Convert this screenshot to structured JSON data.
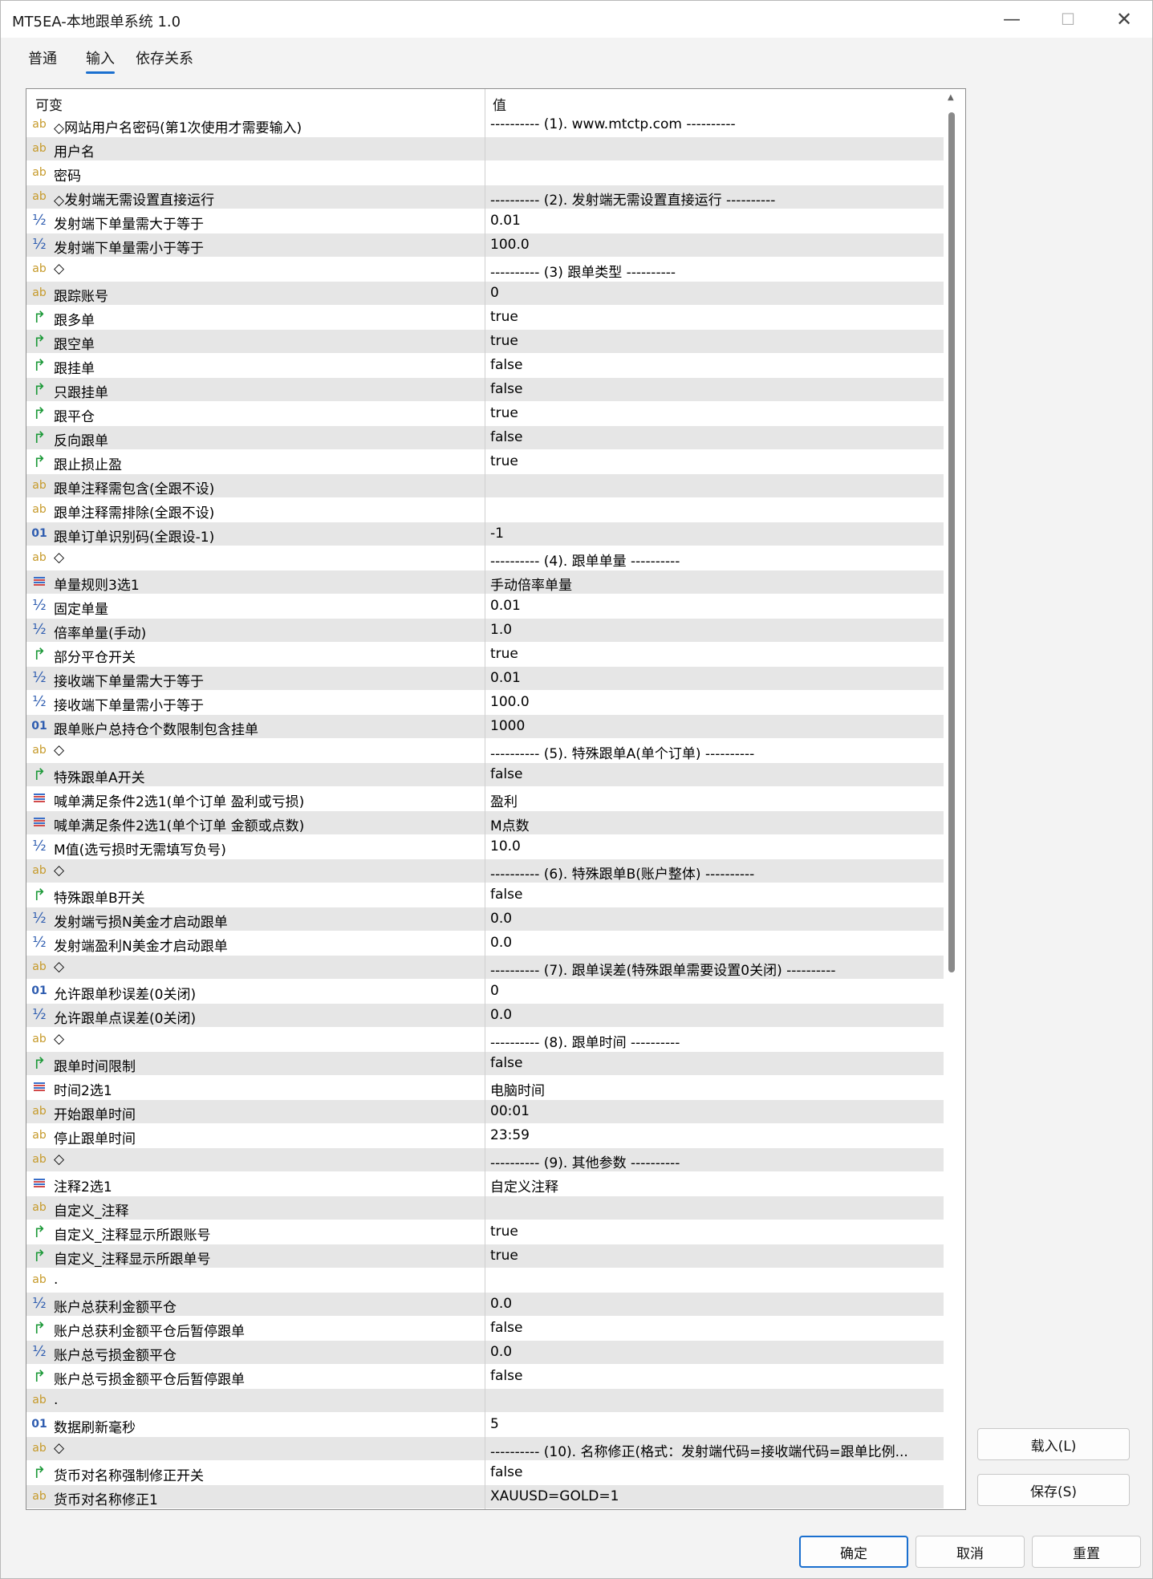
{
  "window": {
    "title": "MT5EA-本地跟单系统 1.0"
  },
  "tabs": [
    {
      "label": "普通",
      "active": false
    },
    {
      "label": "输入",
      "active": true
    },
    {
      "label": "依存关系",
      "active": false
    }
  ],
  "grid": {
    "header": {
      "name": "可变",
      "value": "值"
    },
    "rows": [
      {
        "icon": "ab",
        "name": "◇网站用户名密码(第1次使用才需要输入)",
        "value": "---------- (1). www.mtctp.com ----------"
      },
      {
        "icon": "ab",
        "name": "用户名",
        "value": ""
      },
      {
        "icon": "ab",
        "name": "密码",
        "value": ""
      },
      {
        "icon": "ab",
        "name": "◇发射端无需设置直接运行",
        "value": "---------- (2). 发射端无需设置直接运行 ----------"
      },
      {
        "icon": "half",
        "name": "发射端下单量需大于等于",
        "value": "0.01"
      },
      {
        "icon": "half",
        "name": "发射端下单量需小于等于",
        "value": "100.0"
      },
      {
        "icon": "ab",
        "name": "◇",
        "value": "---------- (3) 跟单类型 ----------"
      },
      {
        "icon": "ab",
        "name": "跟踪账号",
        "value": "0"
      },
      {
        "icon": "bool",
        "name": "跟多单",
        "value": "true"
      },
      {
        "icon": "bool",
        "name": "跟空单",
        "value": "true"
      },
      {
        "icon": "bool",
        "name": "跟挂单",
        "value": "false"
      },
      {
        "icon": "bool",
        "name": "只跟挂单",
        "value": "false"
      },
      {
        "icon": "bool",
        "name": "跟平仓",
        "value": "true"
      },
      {
        "icon": "bool",
        "name": "反向跟单",
        "value": "false"
      },
      {
        "icon": "bool",
        "name": "跟止损止盈",
        "value": "true"
      },
      {
        "icon": "ab",
        "name": "跟单注释需包含(全跟不设)",
        "value": ""
      },
      {
        "icon": "ab",
        "name": "跟单注释需排除(全跟不设)",
        "value": ""
      },
      {
        "icon": "num",
        "name": "跟单订单识别码(全跟设-1)",
        "value": "-1"
      },
      {
        "icon": "ab",
        "name": "◇",
        "value": "---------- (4). 跟单单量 ----------"
      },
      {
        "icon": "enum",
        "name": "单量规则3选1",
        "value": "手动倍率单量"
      },
      {
        "icon": "half",
        "name": "固定单量",
        "value": "0.01"
      },
      {
        "icon": "half",
        "name": "倍率单量(手动)",
        "value": "1.0"
      },
      {
        "icon": "bool",
        "name": "部分平仓开关",
        "value": "true"
      },
      {
        "icon": "half",
        "name": "接收端下单量需大于等于",
        "value": "0.01"
      },
      {
        "icon": "half",
        "name": "接收端下单量需小于等于",
        "value": "100.0"
      },
      {
        "icon": "num",
        "name": "跟单账户总持仓个数限制包含挂单",
        "value": "1000"
      },
      {
        "icon": "ab",
        "name": "◇",
        "value": "---------- (5). 特殊跟单A(单个订单) ----------"
      },
      {
        "icon": "bool",
        "name": "特殊跟单A开关",
        "value": "false"
      },
      {
        "icon": "enum",
        "name": "喊单满足条件2选1(单个订单 盈利或亏损)",
        "value": "盈利"
      },
      {
        "icon": "enum",
        "name": "喊单满足条件2选1(单个订单 金额或点数)",
        "value": "M点数"
      },
      {
        "icon": "half",
        "name": "M值(选亏损时无需填写负号)",
        "value": "10.0"
      },
      {
        "icon": "ab",
        "name": "◇",
        "value": "---------- (6). 特殊跟单B(账户整体) ----------"
      },
      {
        "icon": "bool",
        "name": "特殊跟单B开关",
        "value": "false"
      },
      {
        "icon": "half",
        "name": "发射端亏损N美金才启动跟单",
        "value": "0.0"
      },
      {
        "icon": "half",
        "name": "发射端盈利N美金才启动跟单",
        "value": "0.0"
      },
      {
        "icon": "ab",
        "name": "◇",
        "value": "---------- (7). 跟单误差(特殊跟单需要设置0关闭) ----------"
      },
      {
        "icon": "num",
        "name": "允许跟单秒误差(0关闭)",
        "value": "0"
      },
      {
        "icon": "half",
        "name": "允许跟单点误差(0关闭)",
        "value": "0.0"
      },
      {
        "icon": "ab",
        "name": "◇",
        "value": "---------- (8). 跟单时间 ----------"
      },
      {
        "icon": "bool",
        "name": "跟单时间限制",
        "value": "false"
      },
      {
        "icon": "enum",
        "name": "时间2选1",
        "value": "电脑时间"
      },
      {
        "icon": "ab",
        "name": "开始跟单时间",
        "value": "00:01"
      },
      {
        "icon": "ab",
        "name": "停止跟单时间",
        "value": "23:59"
      },
      {
        "icon": "ab",
        "name": "◇",
        "value": "---------- (9). 其他参数 ----------"
      },
      {
        "icon": "enum",
        "name": "注释2选1",
        "value": "自定义注释"
      },
      {
        "icon": "ab",
        "name": "自定义_注释",
        "value": ""
      },
      {
        "icon": "bool",
        "name": "自定义_注释显示所跟账号",
        "value": "true"
      },
      {
        "icon": "bool",
        "name": "自定义_注释显示所跟单号",
        "value": "true"
      },
      {
        "icon": "ab",
        "name": ".",
        "value": ""
      },
      {
        "icon": "half",
        "name": "账户总获利金额平仓",
        "value": "0.0"
      },
      {
        "icon": "bool",
        "name": "账户总获利金额平仓后暂停跟单",
        "value": "false"
      },
      {
        "icon": "half",
        "name": "账户总亏损金额平仓",
        "value": "0.0"
      },
      {
        "icon": "bool",
        "name": "账户总亏损金额平仓后暂停跟单",
        "value": "false"
      },
      {
        "icon": "ab",
        "name": ".",
        "value": ""
      },
      {
        "icon": "num",
        "name": "数据刷新毫秒",
        "value": "5"
      },
      {
        "icon": "ab",
        "name": "◇",
        "value": "---------- (10). 名称修正(格式：发射端代码=接收端代码=跟单比例..."
      },
      {
        "icon": "bool",
        "name": "货币对名称强制修正开关",
        "value": "false"
      },
      {
        "icon": "ab",
        "name": "货币对名称修正1",
        "value": "XAUUSD=GOLD=1"
      }
    ]
  },
  "side_buttons": {
    "load": "载入(L)",
    "save": "保存(S)"
  },
  "footer": {
    "ok": "确定",
    "cancel": "取消",
    "reset": "重置"
  },
  "icon_glyphs": {
    "ab": "ab",
    "half": "½",
    "bool": "↱",
    "num": "01"
  },
  "colors": {
    "accent": "#1a6fcf",
    "row_alt": "#e6e6e6",
    "ab_icon": "#c69a2a",
    "bool_icon": "#1e9a3a",
    "num_icon": "#2f5db0"
  }
}
